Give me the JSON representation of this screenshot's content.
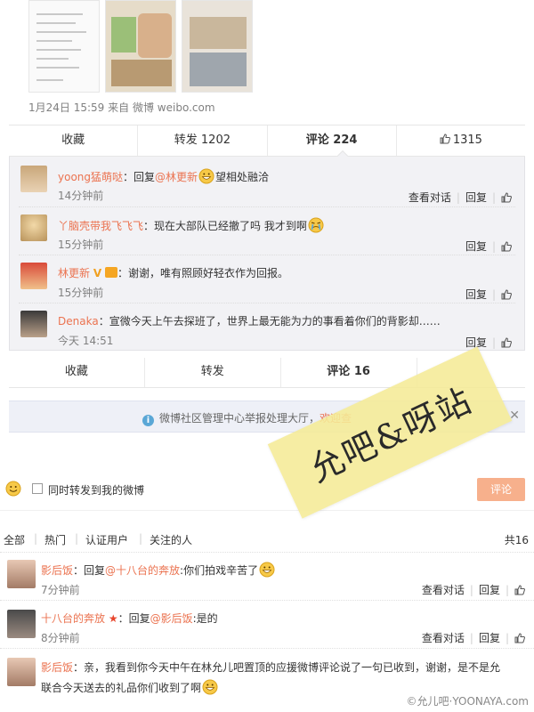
{
  "post": {
    "meta_date": "1月24日 15:59",
    "meta_from": "来自",
    "meta_source": "微博 weibo.com"
  },
  "action_bar_1": {
    "favorite": "收藏",
    "repost": "转发 1202",
    "comment": "评论 224",
    "like": "1315"
  },
  "comments_1": [
    {
      "user": "yoong猛萌哒",
      "text_pre": "：回复",
      "mention": "@林更新",
      "text_post": "望相处融洽",
      "time": "14分钟前",
      "view": "查看对话",
      "reply": "回复"
    },
    {
      "user": "丫脑壳带我飞飞飞",
      "text_pre": "：现在大部队已经撤了吗 我才到啊",
      "mention": "",
      "text_post": "",
      "time": "15分钟前",
      "view": "",
      "reply": "回复"
    },
    {
      "user": "林更新",
      "text_pre": "：谢谢，唯有照顾好轻衣作为回报。",
      "mention": "",
      "text_post": "",
      "time": "15分钟前",
      "view": "",
      "reply": "回复"
    },
    {
      "user": "Denaka",
      "text_pre": "：宣微今天上午去探班了，世界上最无能为力的事看着你们的背影却……",
      "mention": "",
      "text_post": "",
      "time": "今天 14:51",
      "view": "",
      "reply": "回复"
    }
  ],
  "action_bar_2": {
    "favorite": "收藏",
    "repost": "转发",
    "comment": "评论 16"
  },
  "notice": {
    "text": "微博社区管理中心举报处理大厅，",
    "link": "欢迎查"
  },
  "compose": {
    "checkbox_label": "同时转发到我的微博",
    "submit": "评论"
  },
  "filters": {
    "all": "全部",
    "hot": "热门",
    "verified": "认证用户",
    "following": "关注的人",
    "total": "共16"
  },
  "comments_2": [
    {
      "user": "影后饭",
      "text_pre": "：回复",
      "mention": "@十八台的奔放",
      "text_post": ":你们拍戏辛苦了",
      "time": "7分钟前",
      "view": "查看对话",
      "reply": "回复"
    },
    {
      "user": "十八台的奔放",
      "text_pre": "：回复",
      "mention": "@影后饭",
      "text_post": ":是的",
      "time": "8分钟前",
      "view": "查看对话",
      "reply": "回复"
    },
    {
      "user": "影后饭",
      "text_pre": "：亲，我看到你今天中午在林允儿吧置顶的应援微博评论说了一句已收到，谢谢，是不是允",
      "mention": "",
      "text_post": "",
      "line2": "联合今天送去的礼品你们收到了啊",
      "time": "",
      "view": "",
      "reply": ""
    }
  ],
  "watermark": {
    "tape_text": "允吧&呀站",
    "footer": "©允儿吧·YOONAYA.com"
  },
  "colors": {
    "link": "#eb7350",
    "panel": "#f2f2f5",
    "submit": "#f7b08c"
  }
}
